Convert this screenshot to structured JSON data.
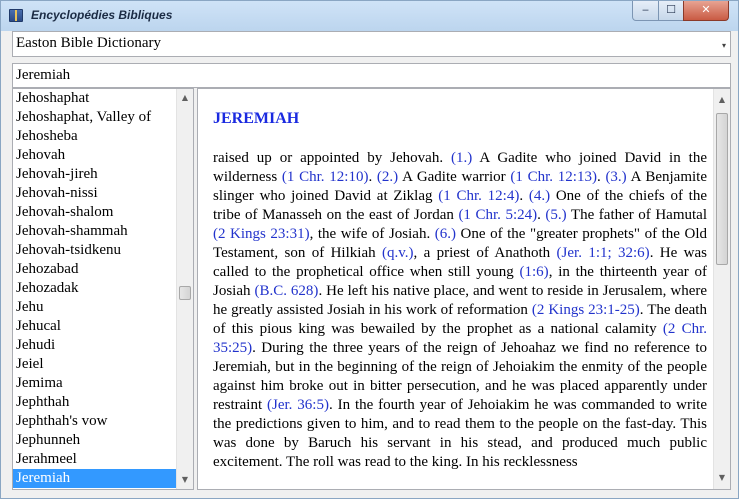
{
  "window": {
    "title": "Encyclopédies Bibliques",
    "minimize": "‒",
    "maximize": "☐",
    "close": "✕"
  },
  "dictionary_select": {
    "selected": "Easton Bible Dictionary",
    "arrow": "▾"
  },
  "search": {
    "value": "Jeremiah"
  },
  "entry_list": {
    "items": [
      "Jehoshaphat",
      "Jehoshaphat, Valley of",
      "Jehosheba",
      "Jehovah",
      "Jehovah-jireh",
      "Jehovah-nissi",
      "Jehovah-shalom",
      "Jehovah-shammah",
      "Jehovah-tsidkenu",
      "Jehozabad",
      "Jehozadak",
      "Jehu",
      "Jehucal",
      "Jehudi",
      "Jeiel",
      "Jemima",
      "Jephthah",
      "Jephthah's vow",
      "Jephunneh",
      "Jerahmeel",
      "Jeremiah"
    ],
    "selected_index": 20,
    "scroll_up": "▲",
    "scroll_down": "▼"
  },
  "article": {
    "title": "JEREMIAH",
    "body": [
      {
        "t": "raised up or appointed by Jehovah. "
      },
      {
        "t": "(1.)",
        "ref": true
      },
      {
        "t": " A Gadite who joined David in the wilderness "
      },
      {
        "t": "(1 Chr. 12:10)",
        "ref": true
      },
      {
        "t": ". "
      },
      {
        "t": "(2.)",
        "ref": true
      },
      {
        "t": " A Gadite warrior "
      },
      {
        "t": "(1 Chr. 12:13)",
        "ref": true
      },
      {
        "t": ". "
      },
      {
        "t": "(3.)",
        "ref": true
      },
      {
        "t": " A Benjamite slinger who joined David at Ziklag "
      },
      {
        "t": "(1 Chr. 12:4)",
        "ref": true
      },
      {
        "t": ". "
      },
      {
        "t": "(4.)",
        "ref": true
      },
      {
        "t": " One of the chiefs of the tribe of Manasseh on the east of Jordan "
      },
      {
        "t": "(1 Chr. 5:24)",
        "ref": true
      },
      {
        "t": ". "
      },
      {
        "t": "(5.)",
        "ref": true
      },
      {
        "t": " The father of Hamutal "
      },
      {
        "t": "(2 Kings 23:31)",
        "ref": true
      },
      {
        "t": ", the wife of Josiah. "
      },
      {
        "t": "(6.)",
        "ref": true
      },
      {
        "t": " One of the \"greater prophets\" of the Old Testament, son of Hilkiah "
      },
      {
        "t": "(q.v.)",
        "ref": true
      },
      {
        "t": ", a priest of Anathoth "
      },
      {
        "t": "(Jer. 1:1; 32:6)",
        "ref": true
      },
      {
        "t": ". He was called to the prophetical office when still young "
      },
      {
        "t": "(1:6)",
        "ref": true
      },
      {
        "t": ", in the thirteenth year of Josiah "
      },
      {
        "t": "(B.C. 628)",
        "ref": true
      },
      {
        "t": ". He left his native place, and went to reside in Jerusalem, where he greatly assisted Josiah in his work of reformation "
      },
      {
        "t": "(2 Kings 23:1-25)",
        "ref": true
      },
      {
        "t": ". The death of this pious king was bewailed by the prophet as a national calamity "
      },
      {
        "t": "(2 Chr. 35:25)",
        "ref": true
      },
      {
        "t": ". During the three years of the reign of Jehoahaz we find no reference to Jeremiah, but in the beginning of the reign of Jehoiakim the enmity of the people against him broke out in bitter persecution, and he was placed apparently under restraint "
      },
      {
        "t": "(Jer. 36:5)",
        "ref": true
      },
      {
        "t": ". In the fourth year of Jehoiakim he was commanded to write the predictions given to him, and to read them to the people on the fast-day. This was done by Baruch his servant in his stead, and produced much public excitement. The roll was read to the king. In his recklessness"
      }
    ],
    "scroll_up": "▲",
    "scroll_down": "▼"
  }
}
